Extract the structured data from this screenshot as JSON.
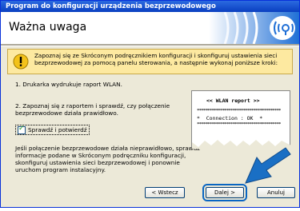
{
  "window": {
    "title": "Program do konfiguracji urządzenia bezprzewodowego"
  },
  "header": {
    "title": "Ważna uwaga"
  },
  "warning": {
    "text": "Zapoznaj się ze Skróconym podręcznikiem konfiguracji i skonfiguruj ustawienia sieci bezprzewodowej za pomocą panelu sterowania, a następnie wykonaj poniższe kroki:"
  },
  "steps": {
    "step1": "1. Drukarka wydrukuje raport WLAN.",
    "step2_line1": "2. Zapoznaj się z raportem i sprawdź, czy połączenie",
    "step2_line2": "bezprzewodowe działa prawidłowo."
  },
  "checkbox": {
    "label": "Sprawdź i potwierdź",
    "checked": true
  },
  "note": {
    "line1": "Jeśli połączenie bezprzewodowe działa nieprawidłowo, sprawdź",
    "line2": "informacje podane w Skróconym podręczniku konfiguracji,",
    "line3": "skonfiguruj ustawienia sieci bezprzewodowej i ponownie",
    "line4": "uruchom program instalacyjny."
  },
  "report": {
    "title": "<< WLAN report >>",
    "connection_label": "Connection",
    "connection_value": "OK"
  },
  "buttons": {
    "back": "< Wstecz",
    "next": "Dalej >",
    "cancel": "Anuluj"
  },
  "colors": {
    "accent": "#0a66c2",
    "title_bar": "#0a3fc0",
    "warning_bg": "#fde9a0"
  },
  "icons": {
    "warning": "warning-icon",
    "wireless": "wireless-icon",
    "pointer": "pointer-arrow"
  }
}
